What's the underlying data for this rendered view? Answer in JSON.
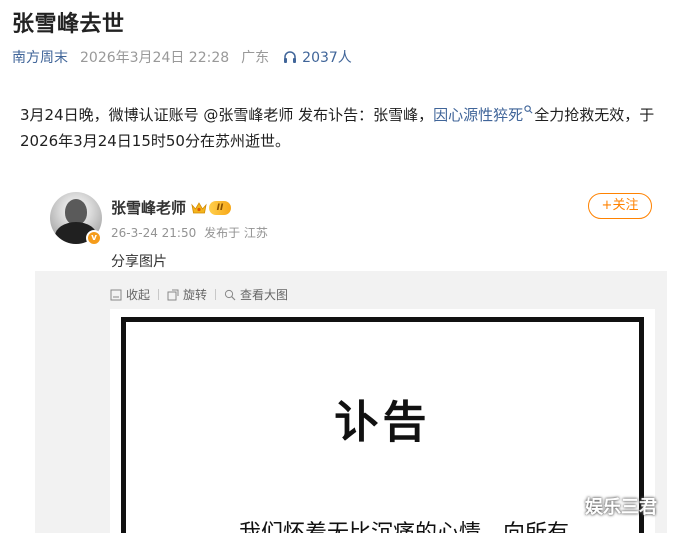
{
  "article": {
    "title": "张雪峰去世",
    "meta": {
      "source": "南方周末",
      "datetime": "2026年3月24日 22:28",
      "location": "广东",
      "listeners": "2037人",
      "listeners_icon": "headphone-icon"
    },
    "body": {
      "before_link": "3月24日晚，微博认证账号 @张雪峰老师 发布讣告：张雪峰，",
      "link_text": "因心源性猝死",
      "after_link": "全力抢救无效，于2026年3月24日15时50分在苏州逝世。"
    }
  },
  "weibo_post": {
    "username": "张雪峰老师",
    "level_badge": "II",
    "verified_icon": "verified-badge-icon",
    "timestamp": "26-3-24 21:50",
    "posted_from": "发布于 江苏",
    "follow_label": "+关注",
    "text": "分享图片",
    "image_toolbar": {
      "collapse_label": "收起",
      "rotate_label": "旋转",
      "view_full_label": "查看大图"
    },
    "obituary_image": {
      "title": "讣告",
      "first_line": "我们怀着无比沉痛的心情，向所有"
    }
  },
  "watermark": "娱乐三君",
  "colors": {
    "link_blue": "#406599",
    "follow_orange": "#ff8200",
    "meta_gray": "#999999",
    "panel_bg": "#f2f2f2"
  }
}
